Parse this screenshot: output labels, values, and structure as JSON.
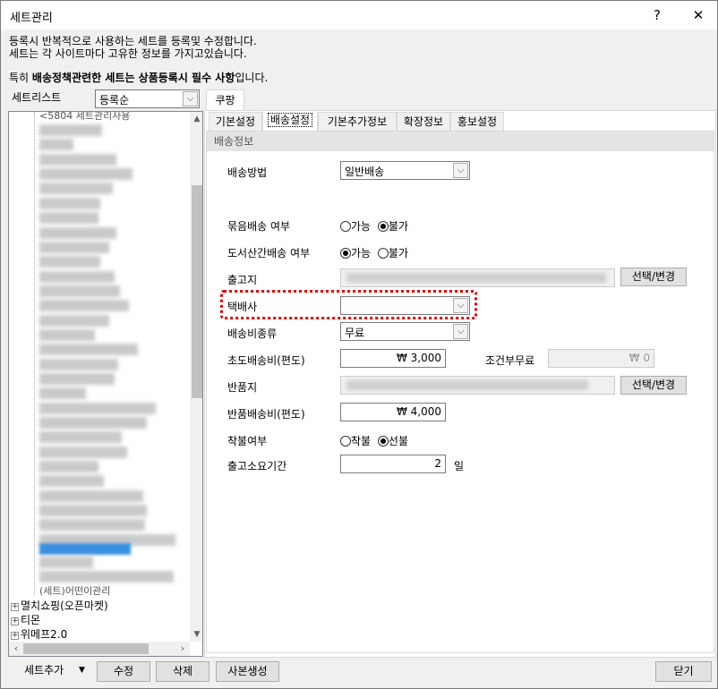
{
  "window": {
    "title": "세트관리",
    "help_glyph": "?",
    "close_glyph": "✕"
  },
  "description": {
    "line1": "등록시 반복적으로 사용하는 세트를 등록및 수정합니다.",
    "line2": "세트는 각 사이트마다 고유한 정보를 가지고있습니다.",
    "line3_prefix": "특히 ",
    "line3_bold": "배송정책관련한 세트는 상품등록시 필수 사항",
    "line3_suffix": "입니다."
  },
  "set_list": {
    "label": "세트리스트",
    "sort_value": "등록순",
    "tree_items": [
      "멸치쇼핑(오픈마켓)",
      "티몬",
      "위메프2.0"
    ],
    "tree_partial": "<5804 세트관리사용",
    "tree_partial_bottom": "(세트)어떤이관리"
  },
  "site_tab": "쿠팡",
  "tabs": [
    "기본설정",
    "배송설정",
    "기본추가정보",
    "확장정보",
    "홍보설정"
  ],
  "active_tab": "배송설정",
  "section_title": "배송정보",
  "form": {
    "shipping_method": {
      "label": "배송방법",
      "value": "일반배송"
    },
    "bundle": {
      "label": "묶음배송 여부",
      "options": [
        "가능",
        "불가"
      ],
      "selected": "불가"
    },
    "island": {
      "label": "도서산간배송 여부",
      "options": [
        "가능",
        "불가"
      ],
      "selected": "가능"
    },
    "origin": {
      "label": "출고지",
      "button": "선택/변경"
    },
    "courier": {
      "label": "택배사",
      "value": ""
    },
    "fee_type": {
      "label": "배송비종류",
      "value": "무료"
    },
    "initial_fee": {
      "label": "초도배송비(편도)",
      "value": "₩      3,000"
    },
    "conditional_free": {
      "label": "조건부무료",
      "value": "₩          0"
    },
    "return_address": {
      "label": "반품지",
      "button": "선택/변경"
    },
    "return_fee": {
      "label": "반품배송비(편도)",
      "value": "₩      4,000"
    },
    "payment": {
      "label": "착불여부",
      "options": [
        "착불",
        "선불"
      ],
      "selected": "선불"
    },
    "lead_time": {
      "label": "출고소요기간",
      "value": "2",
      "unit": "일"
    }
  },
  "bottom": {
    "add_set": "세트추가",
    "add_set_arrow": "▼",
    "edit": "수정",
    "delete": "삭제",
    "copy": "사본생성",
    "close": "닫기"
  }
}
